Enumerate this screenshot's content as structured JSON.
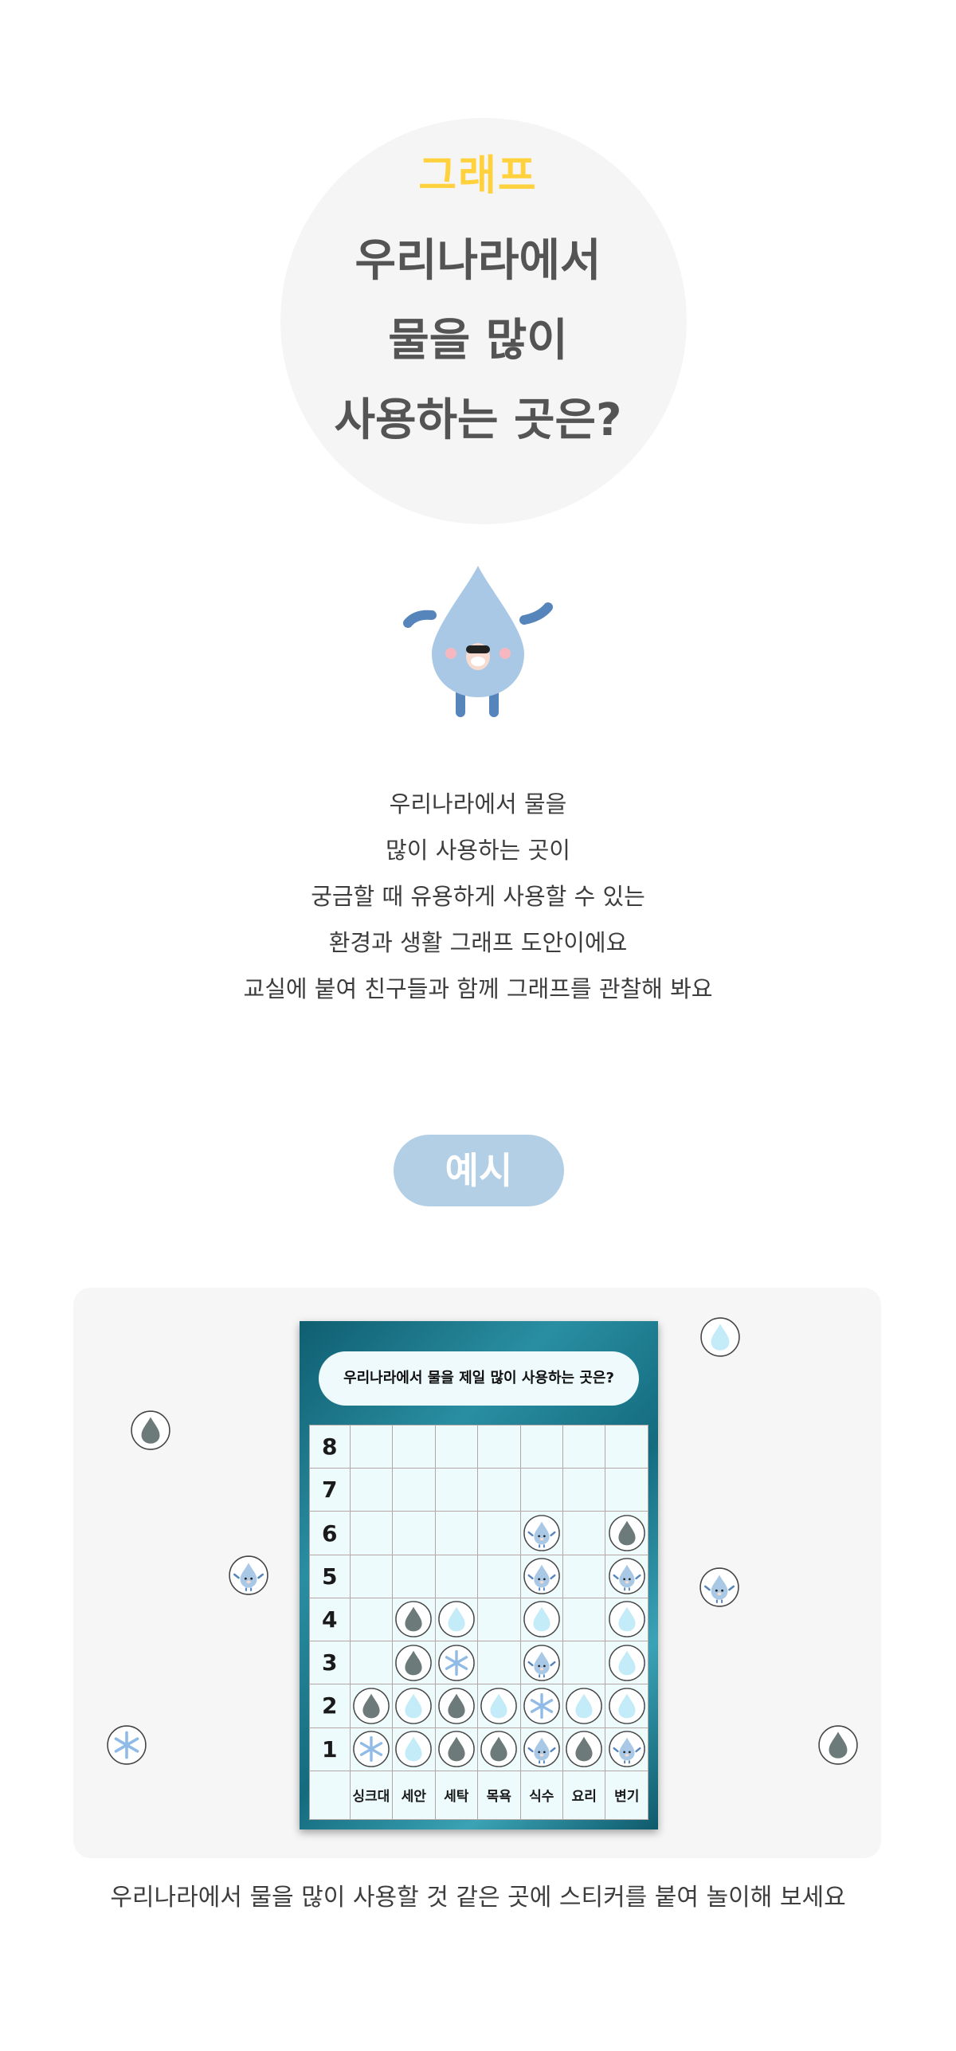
{
  "hero": {
    "tag": "그래프",
    "title_lines": [
      "우리나라에서",
      "물을 많이",
      "사용하는 곳은?"
    ]
  },
  "description_lines": [
    "우리나라에서 물을",
    "많이 사용하는 곳이",
    "궁금할 때 유용하게 사용할 수 있는",
    "환경과 생활 그래프 도안이에요",
    "교실에 붙여 친구들과 함께 그래프를 관찰해 봐요"
  ],
  "example_label": "예시",
  "board": {
    "title": "우리나라에서 물을 제일 많이 사용하는 곳은?",
    "y_labels": [
      "8",
      "7",
      "6",
      "5",
      "4",
      "3",
      "2",
      "1"
    ],
    "x_labels": [
      "싱크대",
      "세안",
      "세탁",
      "목욕",
      "식수",
      "요리",
      "변기"
    ],
    "stickers_by_column": [
      [
        "snow",
        "dark"
      ],
      [
        "light",
        "light",
        "dark",
        "dark"
      ],
      [
        "dark",
        "dark",
        "snow",
        "light"
      ],
      [
        "dark",
        "light"
      ],
      [
        "face",
        "snow",
        "face",
        "light",
        "face",
        "face"
      ],
      [
        "dark",
        "light"
      ],
      [
        "face",
        "light",
        "light",
        "light",
        "face",
        "dark"
      ]
    ]
  },
  "loose_stickers": [
    "light",
    "dark",
    "face",
    "face",
    "snow",
    "dark"
  ],
  "caption": "우리나라에서 물을 많이 사용할 것 같은 곳에 스티커를 붙여 놀이해 보세요",
  "colors": {
    "accent_yellow": "#ffd13c",
    "pill_blue": "#b2cfe6",
    "drop_dark": "#6d7a7a",
    "drop_light": "#c4ecf8",
    "mascot_blue": "#a9c8e6"
  },
  "icons": {
    "dark": "dark-water-drop-sticker-icon",
    "light": "light-water-drop-sticker-icon",
    "snow": "snowflake-sticker-icon",
    "face": "water-drop-character-sticker-icon"
  }
}
